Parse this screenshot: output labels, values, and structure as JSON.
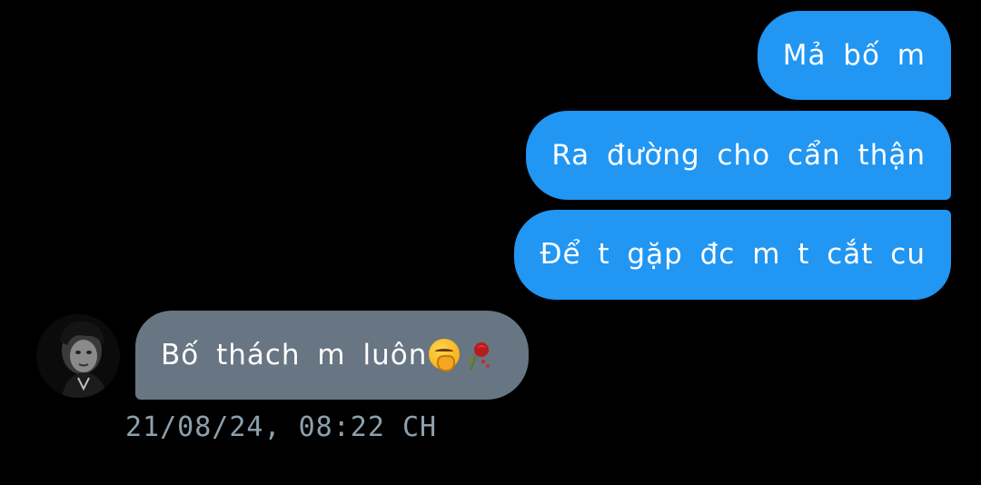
{
  "conversation": {
    "outgoing_messages": [
      "Mả bố m",
      "Ra đường cho cẩn thận",
      "Để t gặp đc m t cắt cu"
    ],
    "incoming_message": {
      "text": "Bố thách m luôn",
      "emojis": [
        "yawning-face-icon",
        "wilted-rose-icon"
      ]
    },
    "timestamp": "21/08/24, 08:22 CH"
  },
  "colors": {
    "background": "#000000",
    "outgoing_bubble": "#2196f3",
    "incoming_bubble": "#687582",
    "timestamp_text": "#8da0ad",
    "message_text": "#ffffff"
  }
}
